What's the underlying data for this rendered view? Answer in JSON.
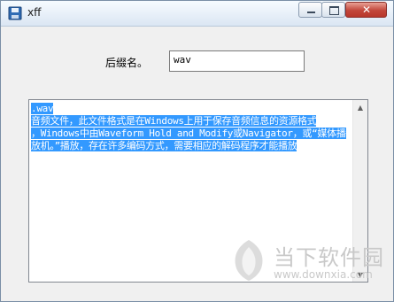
{
  "window": {
    "title": "xff",
    "controls": {
      "minimize": "minimize-icon",
      "maximize": "maximize-icon",
      "close": "close-icon"
    }
  },
  "form": {
    "ext_label": "后缀名。",
    "ext_value": "wav"
  },
  "output": {
    "lines": [
      ".wav",
      "音频文件，此文件格式是在Windows上用于保存音频信息的资源格式",
      "，Windows中由Waveform Hold and Modify或Navigator，或“媒体播",
      "放机。”播放，存在许多编码方式，需要相应的解码程序才能播放"
    ]
  },
  "watermark": {
    "brand": "当下软件园",
    "url": "www.downxia.com"
  },
  "colors": {
    "selection": "#3399ff",
    "window_bg": "#f0f0f0"
  }
}
